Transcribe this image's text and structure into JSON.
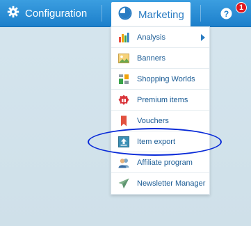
{
  "topbar": {
    "configuration_label": "Configuration",
    "marketing_label": "Marketing",
    "help_badge_count": "1",
    "bar_color": "#2b8fd8"
  },
  "marketing_menu": {
    "items": [
      {
        "label": "Analysis",
        "icon": "bar-chart-icon",
        "has_submenu": true
      },
      {
        "label": "Banners",
        "icon": "image-icon",
        "has_submenu": false
      },
      {
        "label": "Shopping Worlds",
        "icon": "grid-layout-icon",
        "has_submenu": false
      },
      {
        "label": "Premium items",
        "icon": "gift-badge-icon",
        "has_submenu": false
      },
      {
        "label": "Vouchers",
        "icon": "bookmark-voucher-icon",
        "has_submenu": false
      },
      {
        "label": "Item export",
        "icon": "upload-export-icon",
        "has_submenu": false
      },
      {
        "label": "Affiliate program",
        "icon": "users-icon",
        "has_submenu": false
      },
      {
        "label": "Newsletter Manager",
        "icon": "paper-plane-icon",
        "has_submenu": false
      }
    ],
    "highlighted_item": "Item export",
    "highlight_color": "#0a2bd8"
  }
}
